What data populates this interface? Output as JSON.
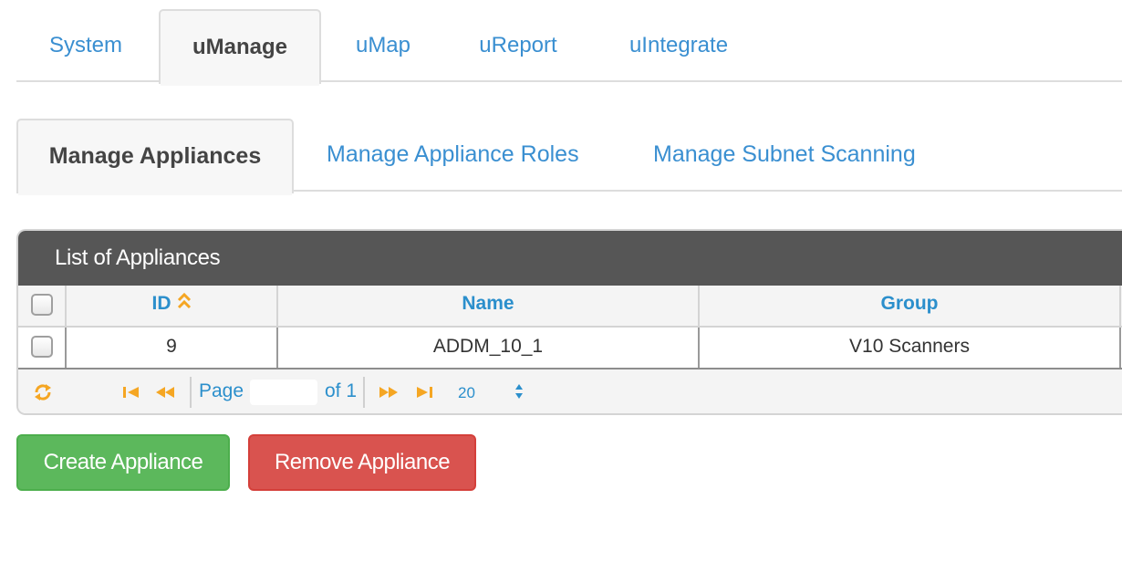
{
  "top_tabs": [
    {
      "label": "System",
      "active": false
    },
    {
      "label": "uManage",
      "active": true
    },
    {
      "label": "uMap",
      "active": false
    },
    {
      "label": "uReport",
      "active": false
    },
    {
      "label": "uIntegrate",
      "active": false
    }
  ],
  "sub_tabs": [
    {
      "label": "Manage Appliances",
      "active": true
    },
    {
      "label": "Manage Appliance Roles",
      "active": false
    },
    {
      "label": "Manage Subnet Scanning",
      "active": false
    }
  ],
  "grid": {
    "caption": "List of Appliances",
    "columns": [
      "ID",
      "Name",
      "Group"
    ],
    "sort": {
      "column": "ID",
      "direction": "ascending"
    },
    "rows": [
      {
        "checked": false,
        "id": "9",
        "name": "ADDM_10_1",
        "group": "V10 Scanners"
      }
    ],
    "pager": {
      "page_label": "Page",
      "page_value": "",
      "of_label": "of 1",
      "page_size": "20"
    }
  },
  "buttons": {
    "create": "Create Appliance",
    "remove": "Remove Appliance"
  },
  "colors": {
    "link": "#3a8fd1",
    "header_text": "#2b8fcc",
    "caption_bg": "#565656",
    "pager_icon": "#f5a623",
    "create_bg": "#5cb85c",
    "remove_bg": "#d9534f"
  },
  "icons": [
    "sort-ascending-icon",
    "refresh-icon",
    "first-page-icon",
    "prev-page-icon",
    "next-page-icon",
    "last-page-icon",
    "select-arrows-icon"
  ]
}
